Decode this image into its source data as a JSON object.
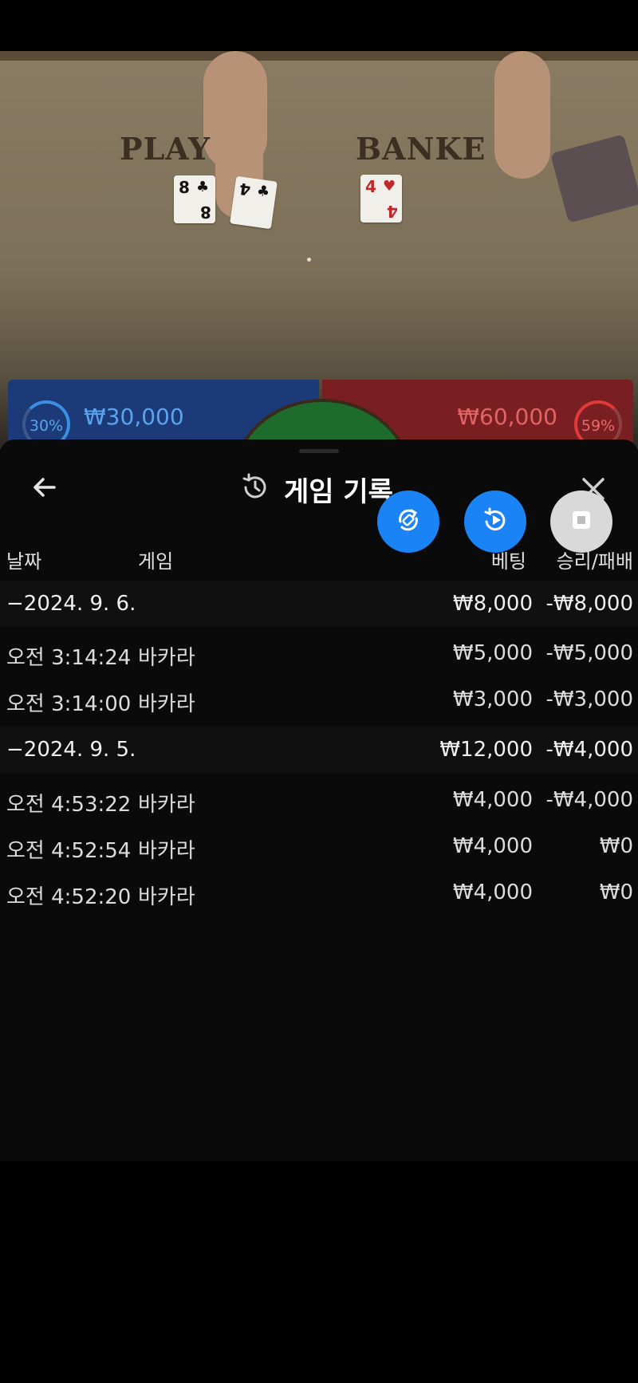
{
  "video": {
    "player_label": "PLAY",
    "banker_label": "BANKE",
    "player_cards": [
      {
        "rank": "8",
        "suit": "♣",
        "color": "black"
      },
      {
        "rank": "4",
        "suit": "♣",
        "color": "black"
      }
    ],
    "banker_cards": [
      {
        "rank": "4",
        "suit": "♥",
        "color": "red"
      }
    ]
  },
  "bets": {
    "player": {
      "percent": "30%",
      "amount": "₩30,000"
    },
    "banker": {
      "percent": "59%",
      "amount": "₩60,000"
    }
  },
  "sheet": {
    "title": "게임 기록",
    "columns": {
      "date": "날짜",
      "game": "게임",
      "bet": "베팅",
      "win_loss": "승리/패배"
    },
    "groups": [
      {
        "date": "−2024. 9. 6.",
        "bet": "₩8,000",
        "win_loss": "-₩8,000",
        "rows": [
          {
            "time": "오전 3:14:24",
            "game": "바카라",
            "bet": "₩5,000",
            "win_loss": "-₩5,000"
          },
          {
            "time": "오전 3:14:00",
            "game": "바카라",
            "bet": "₩3,000",
            "win_loss": "-₩3,000"
          }
        ]
      },
      {
        "date": "−2024. 9. 5.",
        "bet": "₩12,000",
        "win_loss": "-₩4,000",
        "rows": [
          {
            "time": "오전 4:53:22",
            "game": "바카라",
            "bet": "₩4,000",
            "win_loss": "-₩4,000"
          },
          {
            "time": "오전 4:52:54",
            "game": "바카라",
            "bet": "₩4,000",
            "win_loss": "₩0"
          },
          {
            "time": "오전 4:52:20",
            "game": "바카라",
            "bet": "₩4,000",
            "win_loss": "₩0"
          }
        ]
      }
    ]
  },
  "icons": {
    "back": "arrow-left-icon",
    "history": "history-icon",
    "close": "close-icon",
    "rotate": "rotate-icon",
    "replay": "replay-icon",
    "stop": "stop-icon"
  },
  "colors": {
    "accent_blue": "#1a83f5",
    "player_blue": "#5aa4ee",
    "banker_red": "#e06464",
    "sheet_bg": "#0a0a0a"
  }
}
